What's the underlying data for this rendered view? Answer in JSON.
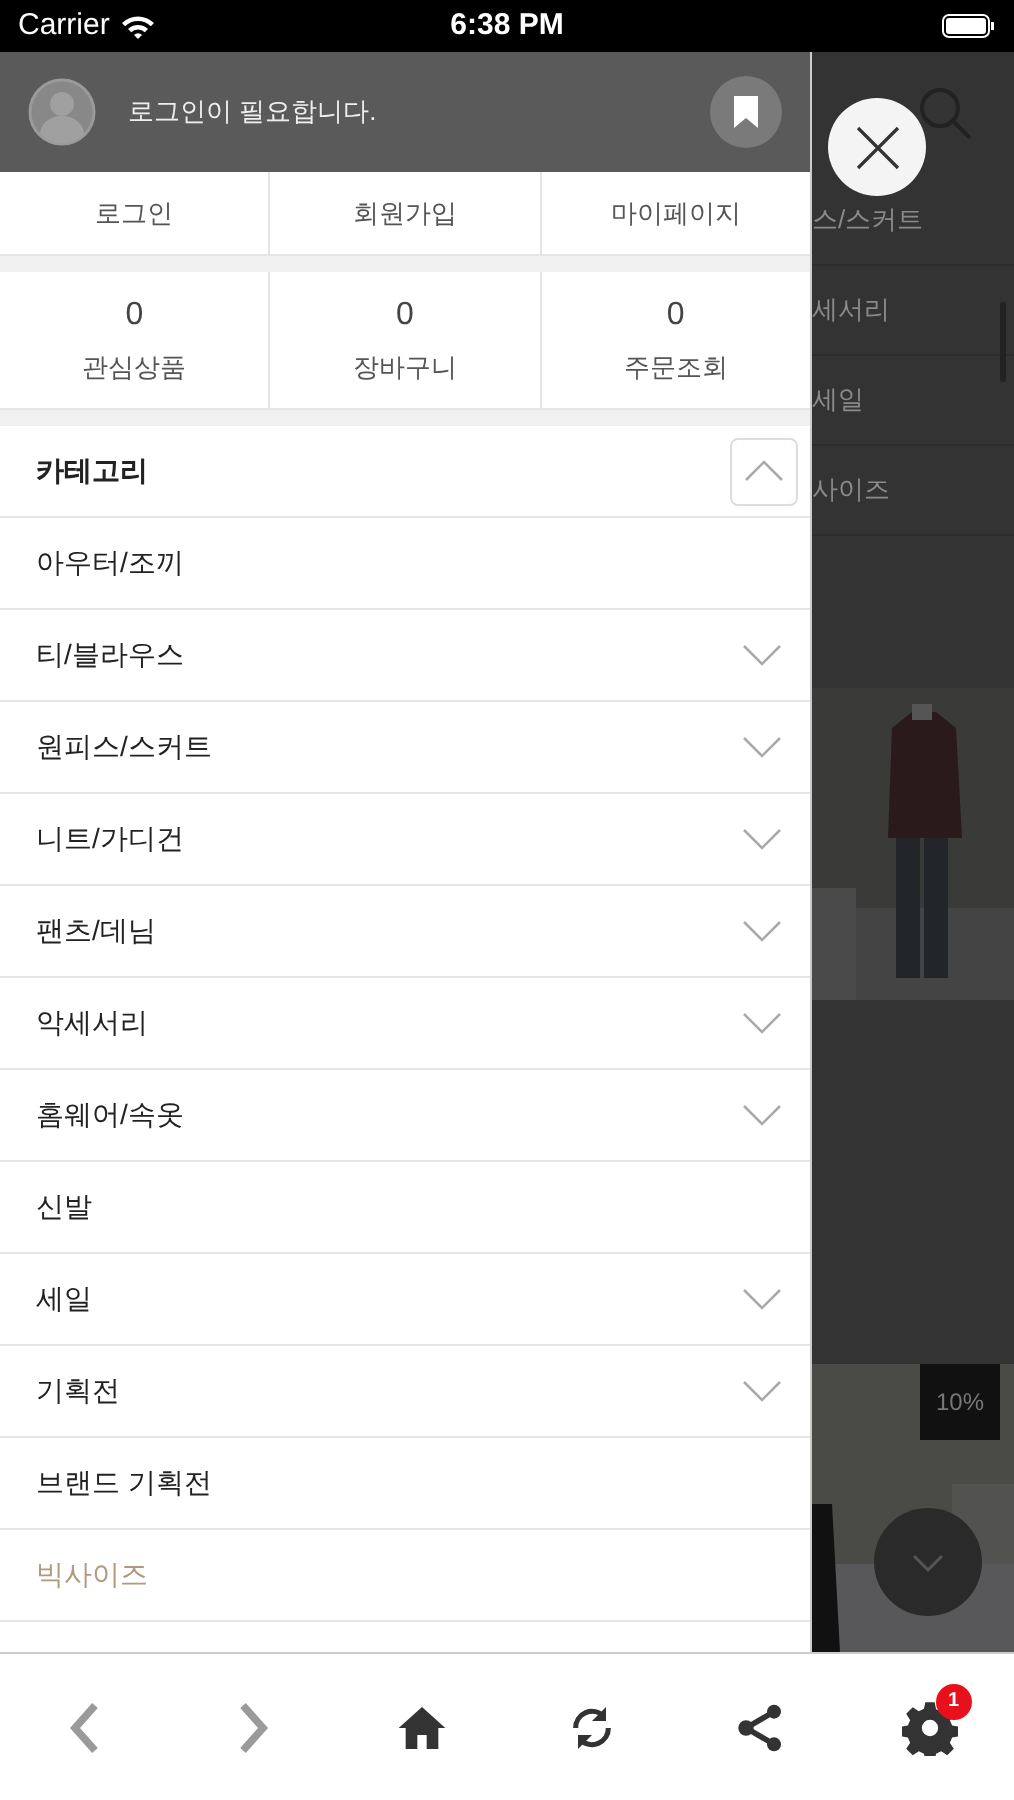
{
  "status_bar": {
    "carrier": "Carrier",
    "time": "6:38 PM"
  },
  "drawer": {
    "login_message": "로그인이 필요합니다.",
    "account_links": [
      "로그인",
      "회원가입",
      "마이페이지"
    ],
    "counters": [
      {
        "count": "0",
        "label": "관심상품"
      },
      {
        "count": "0",
        "label": "장바구니"
      },
      {
        "count": "0",
        "label": "주문조회"
      }
    ],
    "category": {
      "title": "카테고리",
      "expanded": true,
      "items": [
        {
          "label": "아우터/조끼",
          "expandable": false,
          "highlighted": false
        },
        {
          "label": "티/블라우스",
          "expandable": true,
          "highlighted": false
        },
        {
          "label": "원피스/스커트",
          "expandable": true,
          "highlighted": false
        },
        {
          "label": "니트/가디건",
          "expandable": true,
          "highlighted": false
        },
        {
          "label": "팬츠/데님",
          "expandable": true,
          "highlighted": false
        },
        {
          "label": "악세서리",
          "expandable": true,
          "highlighted": false
        },
        {
          "label": "홈웨어/속옷",
          "expandable": true,
          "highlighted": false
        },
        {
          "label": "신발",
          "expandable": false,
          "highlighted": false
        },
        {
          "label": "세일",
          "expandable": true,
          "highlighted": false
        },
        {
          "label": "기획전",
          "expandable": true,
          "highlighted": false
        },
        {
          "label": "브랜드 기획전",
          "expandable": false,
          "highlighted": false
        },
        {
          "label": "빅사이즈",
          "expandable": false,
          "highlighted": true
        }
      ]
    }
  },
  "background_page": {
    "menu_items": [
      "스/스커트",
      "세서리",
      "세일",
      "사이즈"
    ],
    "discount_badge": "10%"
  },
  "toolbar": [
    {
      "kind": "back",
      "disabled": true
    },
    {
      "kind": "forward",
      "disabled": true
    },
    {
      "kind": "home",
      "disabled": false
    },
    {
      "kind": "refresh",
      "disabled": false
    },
    {
      "kind": "share",
      "disabled": false
    },
    {
      "kind": "settings",
      "disabled": false,
      "badge": "1"
    }
  ]
}
